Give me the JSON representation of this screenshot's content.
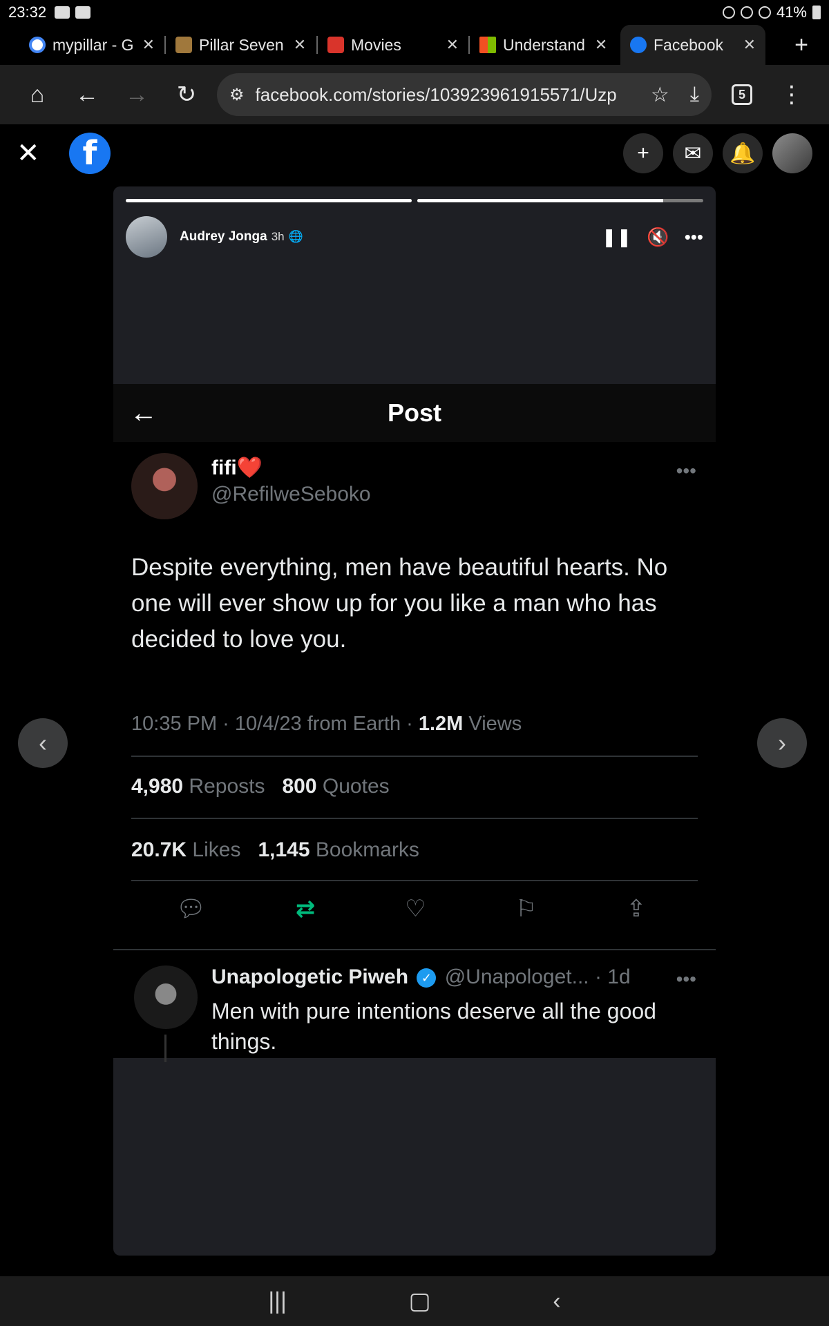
{
  "status_bar": {
    "time": "23:32",
    "battery": "41%"
  },
  "tabs": [
    {
      "label": "mypillar - Go",
      "color": "#ffffff"
    },
    {
      "label": "Pillar Seven",
      "color": "#a0783c"
    },
    {
      "label": "Movies",
      "color": "#d9342b"
    },
    {
      "label": "Understand",
      "color": "#f25022"
    },
    {
      "label": "Facebook",
      "color": "#1877f2"
    }
  ],
  "toolbar": {
    "url": "facebook.com/stories/103923961915571/Uzp",
    "tab_count": "5"
  },
  "story": {
    "author": "Audrey Jonga",
    "time": "3h",
    "progress": [
      1.0,
      0.86
    ]
  },
  "tweet": {
    "nav_title": "Post",
    "author_name": "fifi❤️",
    "author_handle": "@RefilweSeboko",
    "text": "Despite everything, men have beautiful hearts. No one will ever show up for you like a man who has decided to love you.",
    "meta_prefix": "10:35 PM · 10/4/23 from Earth · ",
    "views_count": "1.2M",
    "views_label": " Views",
    "reposts_count": "4,980",
    "reposts_label": "Reposts",
    "quotes_count": "800",
    "quotes_label": "Quotes",
    "likes_count": "20.7K",
    "likes_label": "Likes",
    "bookmarks_count": "1,145",
    "bookmarks_label": "Bookmarks"
  },
  "reply": {
    "name": "Unapologetic Piweh",
    "handle": "@Unapologet... · 1d",
    "text": "Men with pure intentions deserve all the good things."
  },
  "icons": {
    "home": "home-icon",
    "back": "back-arrow-icon",
    "forward": "forward-arrow-icon",
    "reload": "reload-icon",
    "star": "star-icon",
    "download": "download-icon",
    "menu": "more-vert-icon",
    "messenger": "messenger-icon",
    "bell": "bell-icon"
  }
}
